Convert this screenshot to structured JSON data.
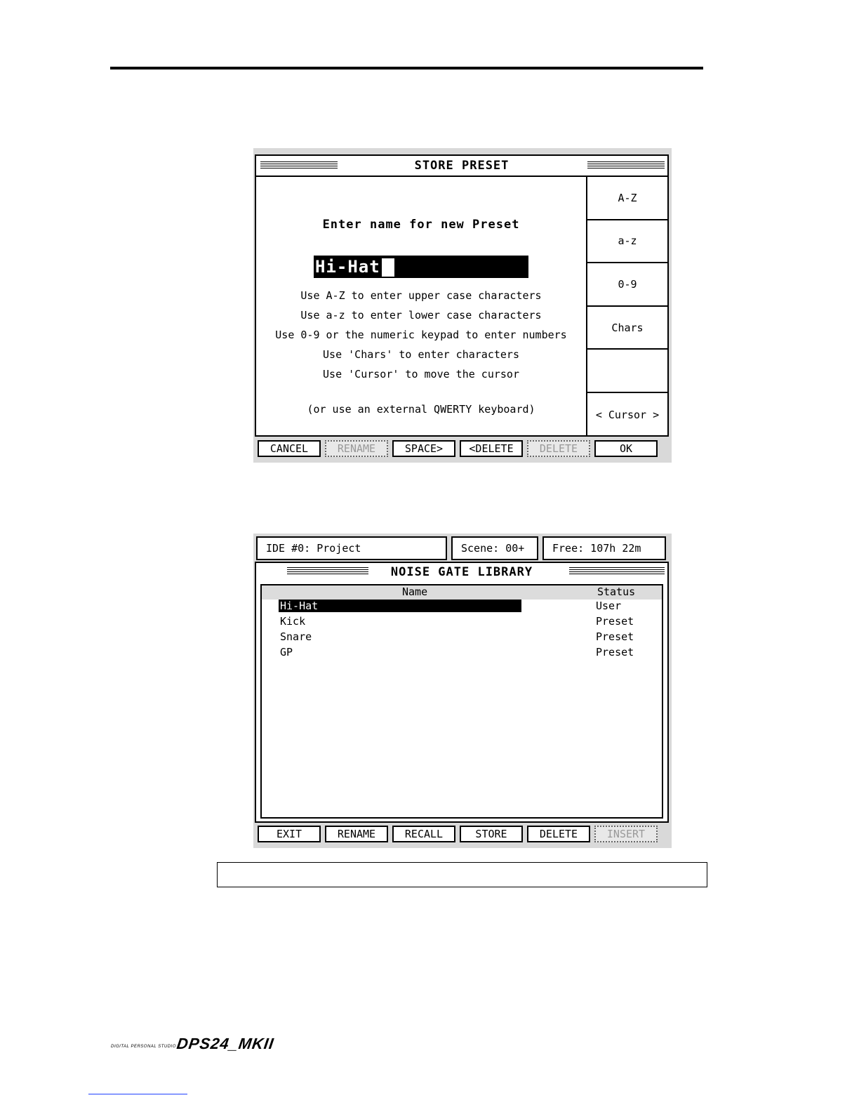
{
  "store_preset": {
    "title": "STORE PRESET",
    "prompt": "Enter name for new Preset",
    "name_value": "Hi-Hat",
    "help_lines": [
      "Use A-Z to enter upper case characters",
      "Use a-z to enter lower case characters",
      "Use 0-9 or the numeric keypad to enter numbers",
      "Use 'Chars' to enter characters",
      "Use 'Cursor' to move the cursor"
    ],
    "external_hint": "(or use an external QWERTY keyboard)",
    "side_buttons": [
      "A-Z",
      "a-z",
      "0-9",
      "Chars",
      "",
      "< Cursor >"
    ],
    "bottom_buttons": [
      {
        "label": "CANCEL",
        "enabled": true
      },
      {
        "label": "RENAME",
        "enabled": false
      },
      {
        "label": "SPACE>",
        "enabled": true
      },
      {
        "label": "<DELETE",
        "enabled": true
      },
      {
        "label": "DELETE",
        "enabled": false
      },
      {
        "label": "OK",
        "enabled": true
      }
    ]
  },
  "library": {
    "status_drive": "IDE #0: Project",
    "status_scene": "Scene: 00+",
    "status_free": "Free: 107h 22m",
    "title": "NOISE GATE LIBRARY",
    "col_name": "Name",
    "col_status": "Status",
    "rows": [
      {
        "name": "Hi-Hat",
        "status": "User"
      },
      {
        "name": "Kick",
        "status": "Preset"
      },
      {
        "name": "Snare",
        "status": "Preset"
      },
      {
        "name": "GP",
        "status": "Preset"
      }
    ],
    "bottom_buttons": [
      {
        "label": "EXIT",
        "enabled": true
      },
      {
        "label": "RENAME",
        "enabled": true
      },
      {
        "label": "RECALL",
        "enabled": true
      },
      {
        "label": "STORE",
        "enabled": true
      },
      {
        "label": "DELETE",
        "enabled": true
      },
      {
        "label": "INSERT",
        "enabled": false
      }
    ]
  },
  "footer": {
    "small_text": "DIGITAL PERSONAL STUDIO",
    "logo_text": "DPS24_MKII"
  }
}
